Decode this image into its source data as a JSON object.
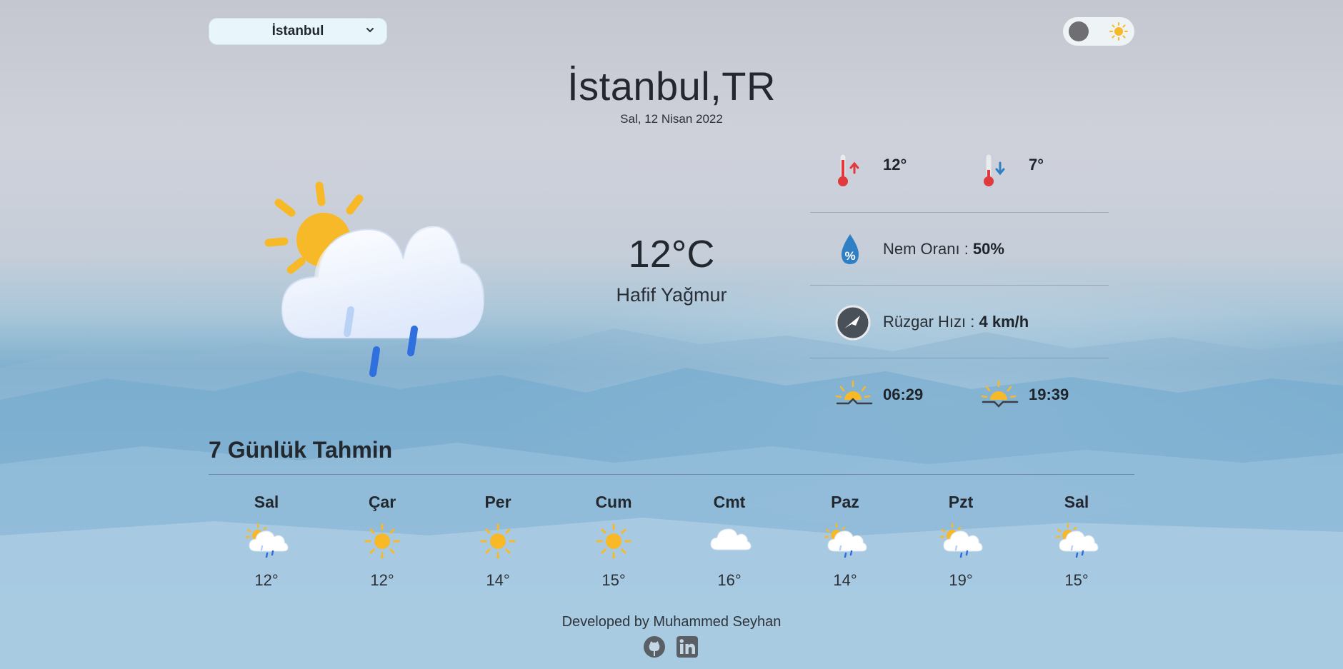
{
  "search": {
    "selected_city": "İstanbul"
  },
  "theme": {
    "mode": "light"
  },
  "header": {
    "city": "İstanbul,TR",
    "date": "Sal, 12 Nisan 2022"
  },
  "current": {
    "temperature": "12°C",
    "description": "Hafif Yağmur",
    "icon": "sun-cloud-rain-icon"
  },
  "details": {
    "max_temp": "12°",
    "min_temp": "7°",
    "humidity_label": "Nem Oranı : ",
    "humidity_value": "50%",
    "wind_label": "Rüzgar Hızı : ",
    "wind_value": "4 km/h",
    "sunrise": "06:29",
    "sunset": "19:39"
  },
  "forecast": {
    "title": "7 Günlük Tahmin",
    "days": [
      {
        "day": "Sal",
        "temp": "12°",
        "icon": "sun-cloud-rain-icon"
      },
      {
        "day": "Çar",
        "temp": "12°",
        "icon": "sun-icon"
      },
      {
        "day": "Per",
        "temp": "14°",
        "icon": "sun-icon"
      },
      {
        "day": "Cum",
        "temp": "15°",
        "icon": "sun-icon"
      },
      {
        "day": "Cmt",
        "temp": "16°",
        "icon": "cloud-icon"
      },
      {
        "day": "Paz",
        "temp": "14°",
        "icon": "sun-cloud-rain-icon"
      },
      {
        "day": "Pzt",
        "temp": "19°",
        "icon": "sun-cloud-rain-icon"
      },
      {
        "day": "Sal",
        "temp": "15°",
        "icon": "sun-cloud-rain-icon"
      }
    ]
  },
  "footer": {
    "credit": "Developed by Muhammed Seyhan",
    "links": [
      "github-icon",
      "linkedin-icon"
    ]
  },
  "colors": {
    "sun": "#f7b928",
    "rain": "#2f6fde",
    "thermo": "#e0393e",
    "drop": "#2e7fc4"
  }
}
